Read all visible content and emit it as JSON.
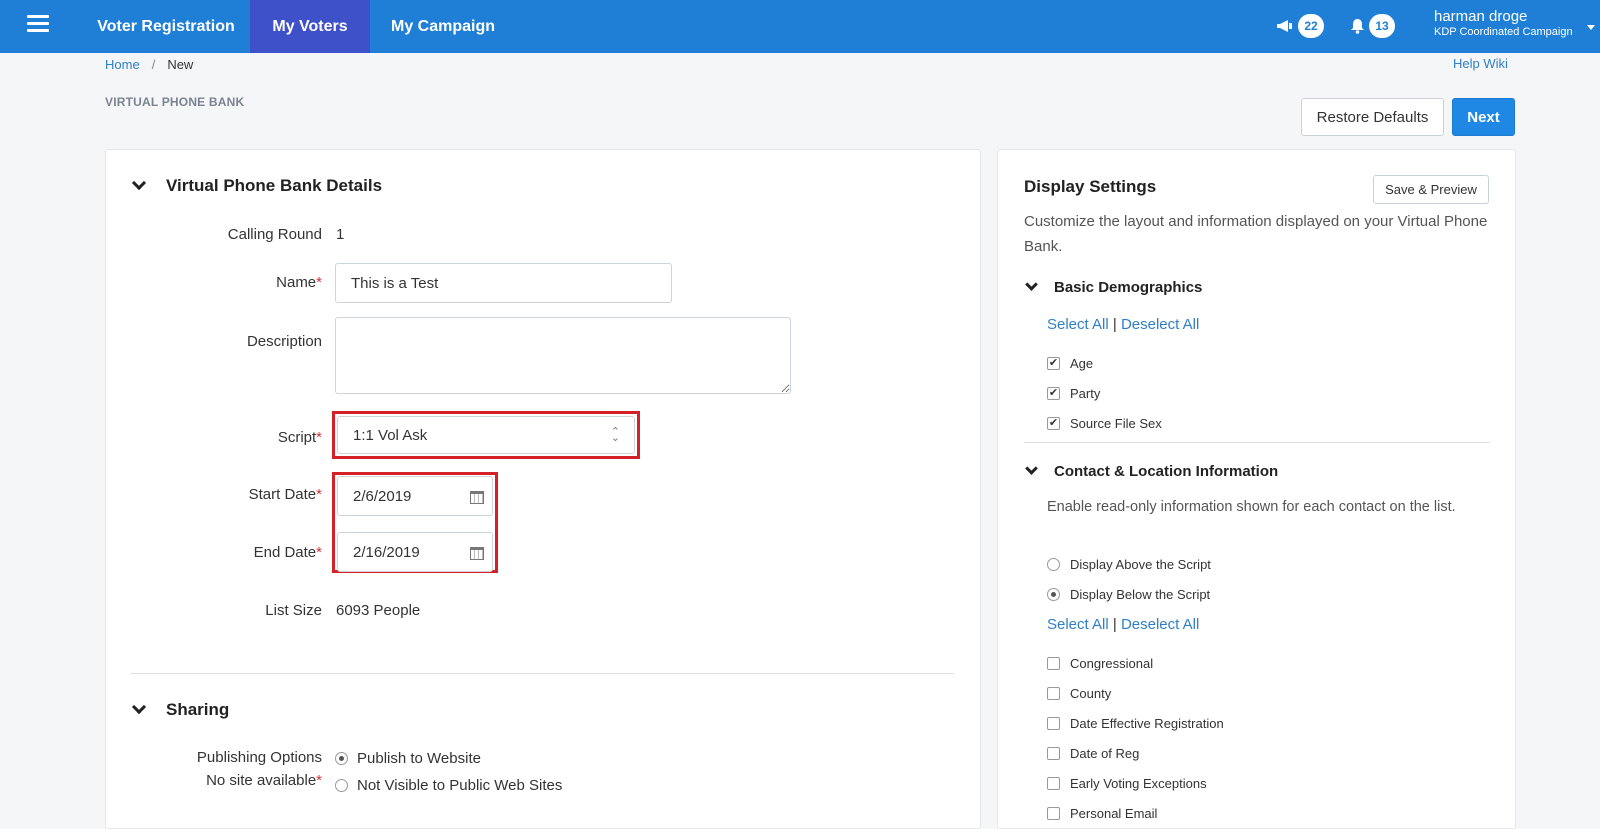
{
  "nav": {
    "tabs": [
      "Voter Registration",
      "My Voters",
      "My Campaign"
    ],
    "active_tab": "My Voters",
    "announcements_count": "22",
    "notifications_count": "13",
    "user_name": "harman droge",
    "user_campaign": "KDP Coordinated Campaign"
  },
  "breadcrumb": {
    "home": "Home",
    "sep": "/",
    "current": "New"
  },
  "help_link": "Help Wiki",
  "page_title": "VIRTUAL PHONE BANK",
  "actions": {
    "restore": "Restore Defaults",
    "next": "Next"
  },
  "details": {
    "title": "Virtual Phone Bank Details",
    "calling_round_label": "Calling Round",
    "calling_round_value": "1",
    "name_label": "Name",
    "name_value": "This is a Test",
    "description_label": "Description",
    "description_value": "",
    "script_label": "Script",
    "script_value": "1:1 Vol Ask",
    "start_date_label": "Start Date",
    "start_date_value": "2/6/2019",
    "end_date_label": "End Date",
    "end_date_value": "2/16/2019",
    "list_size_label": "List Size",
    "list_size_value": "6093 People",
    "required_mark": "*"
  },
  "sharing": {
    "title": "Sharing",
    "publishing_label": "Publishing Options",
    "no_site_label": "No site available",
    "options": [
      "Publish to Website",
      "Not Visible to Public Web Sites"
    ],
    "selected": "Publish to Website"
  },
  "display_settings": {
    "title": "Display Settings",
    "save_preview": "Save & Preview",
    "description": "Customize the layout and information displayed on your Virtual Phone Bank.",
    "select_all": "Select All",
    "deselect_all": "Deselect All",
    "pipe": "|",
    "basic": {
      "title": "Basic Demographics",
      "items": [
        {
          "label": "Age",
          "checked": true
        },
        {
          "label": "Party",
          "checked": true
        },
        {
          "label": "Source File Sex",
          "checked": true
        }
      ]
    },
    "contact": {
      "title": "Contact & Location Information",
      "description": "Enable read-only information shown for each contact on the list.",
      "placement_options": [
        "Display Above the Script",
        "Display Below the Script"
      ],
      "placement_selected": "Display Below the Script",
      "items": [
        {
          "label": "Congressional",
          "checked": false
        },
        {
          "label": "County",
          "checked": false
        },
        {
          "label": "Date Effective Registration",
          "checked": false
        },
        {
          "label": "Date of Reg",
          "checked": false
        },
        {
          "label": "Early Voting Exceptions",
          "checked": false
        },
        {
          "label": "Personal Email",
          "checked": false
        }
      ]
    }
  }
}
